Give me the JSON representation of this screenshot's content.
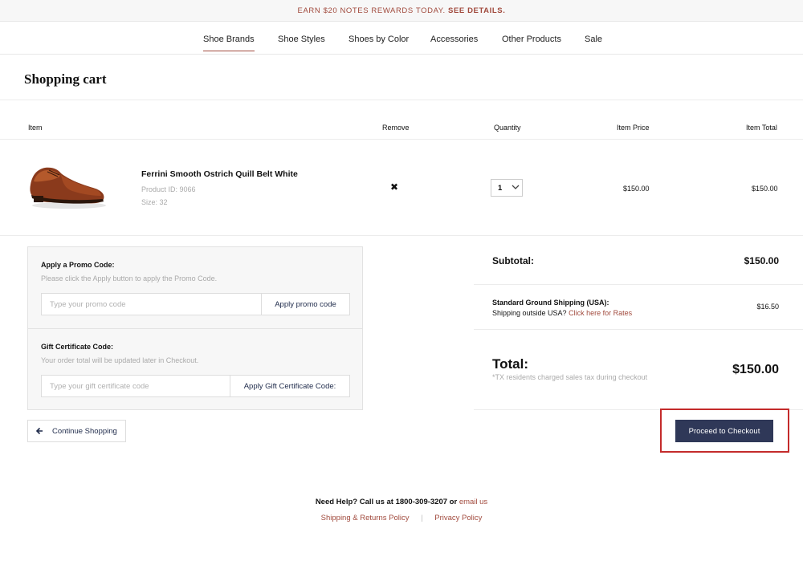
{
  "promo_bar": {
    "text": "EARN $20 NOTES REWARDS TODAY.",
    "link": "SEE DETAILS."
  },
  "nav": {
    "items": [
      "Shoe Brands",
      "Shoe Styles",
      "Shoes by Color",
      "Accessories",
      "Other Products",
      "Sale"
    ],
    "active": "Shoe Brands"
  },
  "page": {
    "title": "Shopping cart"
  },
  "table": {
    "headers": {
      "item": "Item",
      "remove": "Remove",
      "quantity": "Quantity",
      "item_price": "Item Price",
      "item_total": "Item Total"
    }
  },
  "cart_item": {
    "name": "Ferrini Smooth Ostrich Quill Belt White",
    "product_id": "Product ID: 9066",
    "size": "Size: 32",
    "remove_symbol": "✖",
    "quantity": "1",
    "price": "$150.00",
    "total": "$150.00"
  },
  "promo": {
    "label": "Apply a Promo Code:",
    "help": "Please click the Apply button to apply the Promo Code.",
    "placeholder": "Type your promo code",
    "button": "Apply promo code"
  },
  "gift": {
    "label": "Gift Certificate Code:",
    "help": "Your order total will be updated later in Checkout.",
    "placeholder": "Type your gift certificate code",
    "button": "Apply Gift Certificate Code:"
  },
  "continue_label": "Continue Shopping",
  "summary": {
    "subtotal_label": "Subtotal:",
    "subtotal_value": "$150.00",
    "shipping_label": "Standard Ground Shipping (USA):",
    "shipping_outside": "Shipping outside USA?",
    "shipping_rates_link": "Click here for Rates",
    "shipping_value": "$16.50",
    "total_label": "Total:",
    "total_note": "*TX residents charged sales tax during checkout",
    "total_value": "$150.00"
  },
  "checkout_label": "Proceed to Checkout",
  "footer": {
    "help_text": "Need Help? Call us at 1800-309-3207 or",
    "email_link": "email us",
    "shipping_policy": "Shipping & Returns Policy",
    "separator": "|",
    "privacy_policy": "Privacy Policy"
  },
  "colors": {
    "accent": "#a14a3d",
    "button": "#2f3858",
    "highlight": "#c42b2b"
  }
}
